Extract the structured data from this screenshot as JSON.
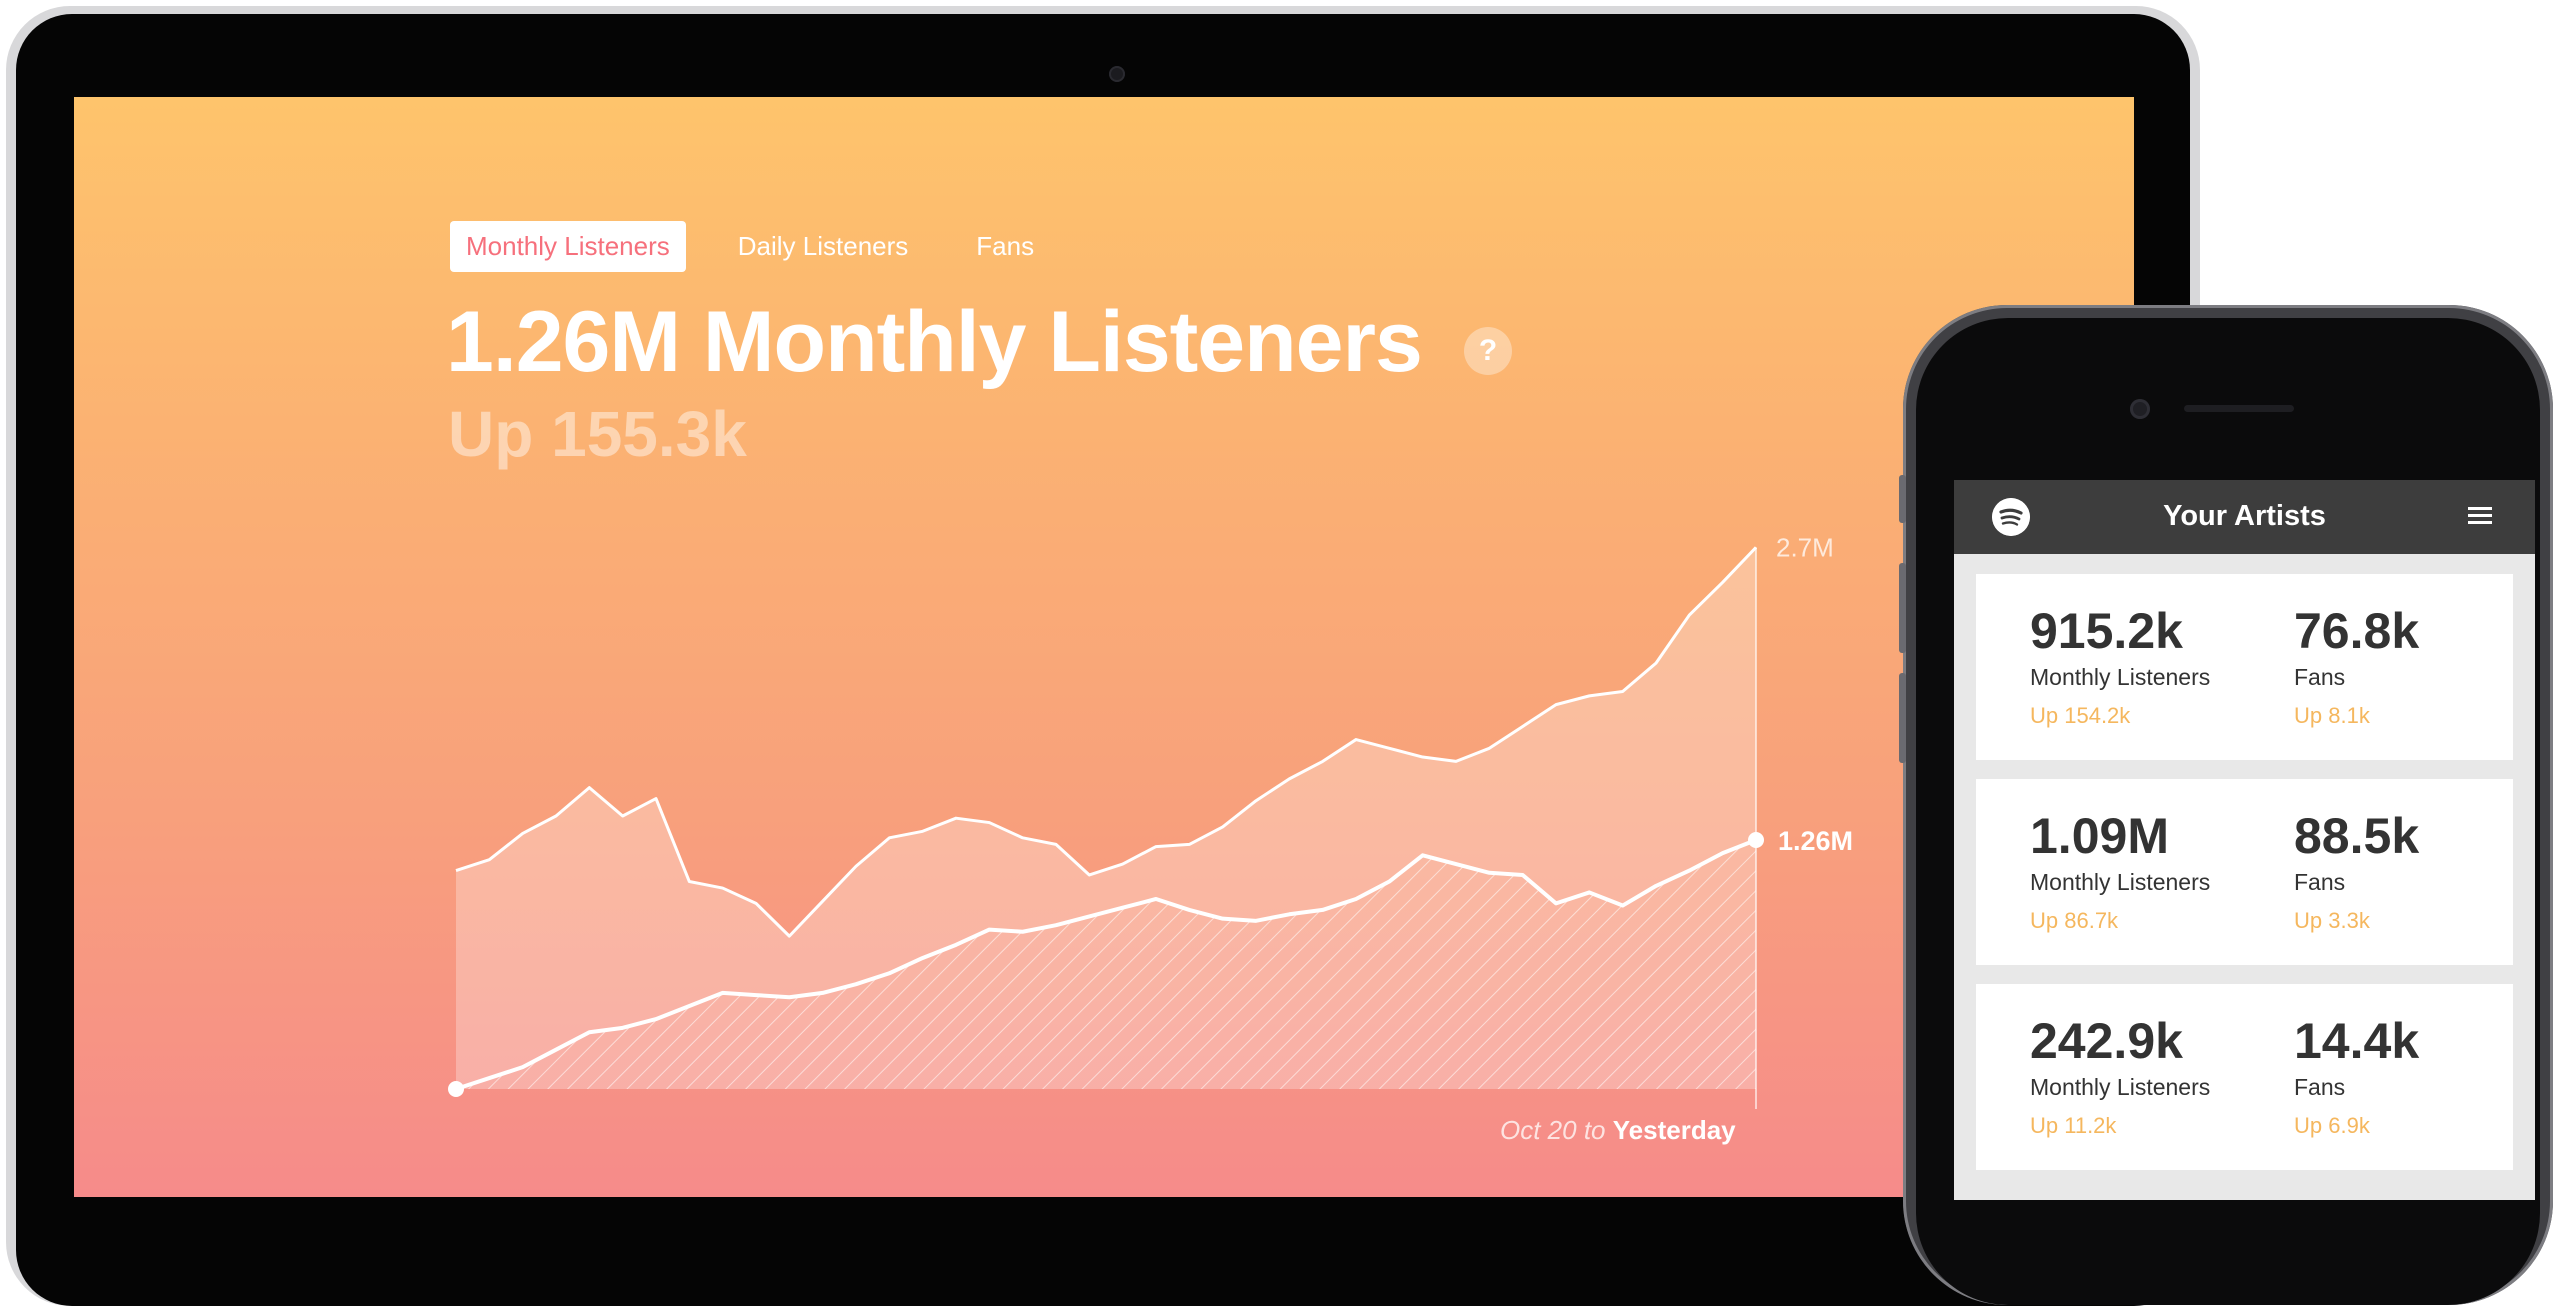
{
  "tabs": [
    {
      "label": "Monthly Listeners",
      "active": true
    },
    {
      "label": "Daily Listeners",
      "active": false
    },
    {
      "label": "Fans",
      "active": false
    }
  ],
  "headline": "1.26M Monthly Listeners",
  "help_icon_glyph": "?",
  "subhead": "Up 155.3k",
  "date_range": {
    "start": "Oct 20",
    "connector": "to",
    "end": "Yesterday"
  },
  "chart_data": {
    "type": "area",
    "series": [
      {
        "values": [
          1.0,
          1.05,
          1.17,
          1.25,
          1.38,
          1.25,
          1.33,
          0.95,
          0.92,
          0.85,
          0.7,
          0.86,
          1.02,
          1.15,
          1.18,
          1.24,
          1.22,
          1.15,
          1.12,
          0.98,
          1.03,
          1.11,
          1.12,
          1.2,
          1.32,
          1.42,
          1.5,
          1.6,
          1.56,
          1.52,
          1.5,
          1.56,
          1.66,
          1.76,
          1.8,
          1.82,
          1.95,
          2.17,
          2.32,
          2.48
        ]
      },
      {
        "values": [
          0.0,
          0.05,
          0.1,
          0.18,
          0.26,
          0.28,
          0.32,
          0.38,
          0.44,
          0.43,
          0.42,
          0.44,
          0.48,
          0.53,
          0.6,
          0.66,
          0.73,
          0.72,
          0.75,
          0.79,
          0.83,
          0.87,
          0.82,
          0.78,
          0.77,
          0.8,
          0.82,
          0.87,
          0.95,
          1.07,
          1.03,
          0.99,
          0.98,
          0.85,
          0.9,
          0.84,
          0.93,
          1.0,
          1.08,
          1.14
        ]
      }
    ],
    "end_labels": [
      "2.7M",
      "1.26M"
    ],
    "grid": false
  },
  "phone": {
    "title": "Your Artists",
    "artists": [
      {
        "listeners": "915.2k",
        "listeners_label": "Monthly Listeners",
        "listeners_change": "Up 154.2k",
        "fans": "76.8k",
        "fans_label": "Fans",
        "fans_change": "Up 8.1k"
      },
      {
        "listeners": "1.09M",
        "listeners_label": "Monthly Listeners",
        "listeners_change": "Up 86.7k",
        "fans": "88.5k",
        "fans_label": "Fans",
        "fans_change": "Up 3.3k"
      },
      {
        "listeners": "242.9k",
        "listeners_label": "Monthly Listeners",
        "listeners_change": "Up 11.2k",
        "fans": "14.4k",
        "fans_label": "Fans",
        "fans_change": "Up 6.9k"
      }
    ]
  },
  "colors": {
    "accent": "#f6707c",
    "highlight": "#f5b75e",
    "header_dark": "#3d3d3d"
  },
  "icons": [
    "help-icon",
    "spotify-logo-icon",
    "menu-icon"
  ]
}
